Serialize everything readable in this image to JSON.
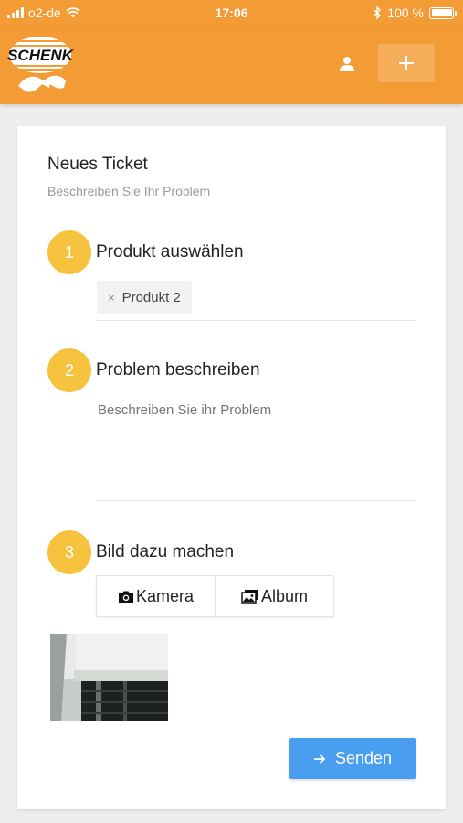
{
  "status_bar": {
    "carrier": "o2-de",
    "time": "17:06",
    "battery": "100 %",
    "icons": [
      "signal-icon",
      "wifi-icon",
      "bluetooth-icon",
      "battery-icon"
    ]
  },
  "app_bar": {
    "logo_text": "SCHENK",
    "user_icon": "person-icon",
    "add_label": "+"
  },
  "ticket": {
    "title": "Neues Ticket",
    "subtitle": "Beschreiben Sie Ihr Problem",
    "steps": [
      {
        "number": "1",
        "title": "Produkt auswählen"
      },
      {
        "number": "2",
        "title": "Problem beschreiben"
      },
      {
        "number": "3",
        "title": "Bild dazu machen"
      }
    ],
    "selected_product": "Produkt 2",
    "remove_glyph": "×",
    "description_placeholder": "Beschreiben Sie ihr Problem",
    "description_value": "",
    "camera_label": "Kamera",
    "album_label": "Album",
    "send_label": "Senden"
  },
  "colors": {
    "primary": "#f39b35",
    "step": "#f6c33e",
    "send": "#4a9ef0"
  }
}
